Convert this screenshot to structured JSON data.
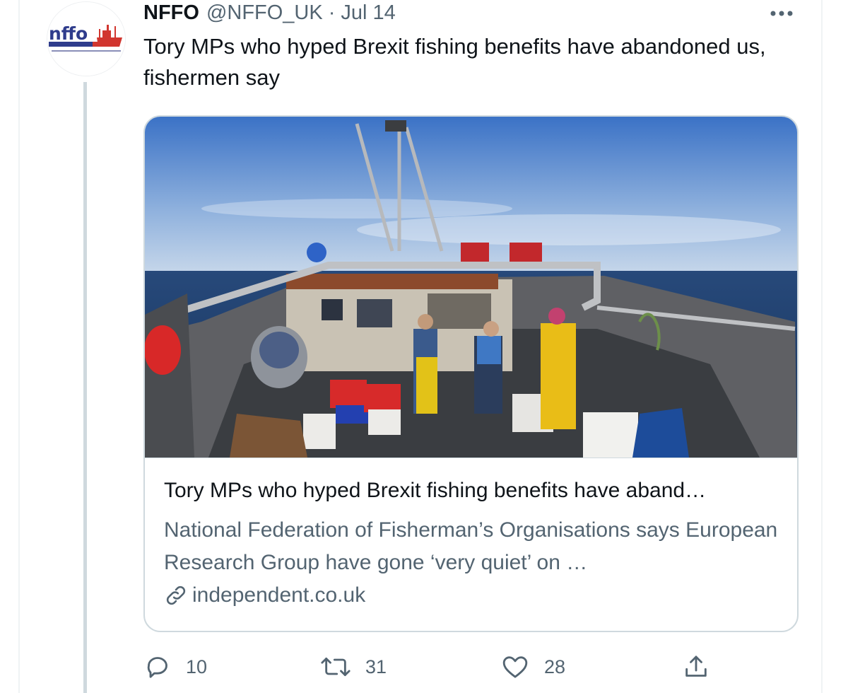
{
  "tweet": {
    "display_name": "NFFO",
    "handle": "@NFFO_UK",
    "separator": "·",
    "date": "Jul 14",
    "text": "Tory MPs who hyped Brexit fishing benefits have abandoned us, fishermen say",
    "avatar_icon": "nffo-logo-icon"
  },
  "card": {
    "title": "Tory MPs who hyped Brexit fishing benefits have aband…",
    "description": "National Federation of Fisherman’s Organisations says European Research Group have gone ‘very quiet’ on …",
    "domain": "independent.co.uk",
    "link_icon": "link-icon",
    "image_subject": "fishing-boat-deck-photo"
  },
  "actions": {
    "replies": "10",
    "retweets": "31",
    "likes": "28",
    "share_icon": "share-icon"
  },
  "colors": {
    "text_primary": "#0f1419",
    "text_secondary": "#536471",
    "border": "#cfd9de",
    "logo_blue": "#2f3c8c",
    "logo_red": "#d1362f"
  }
}
